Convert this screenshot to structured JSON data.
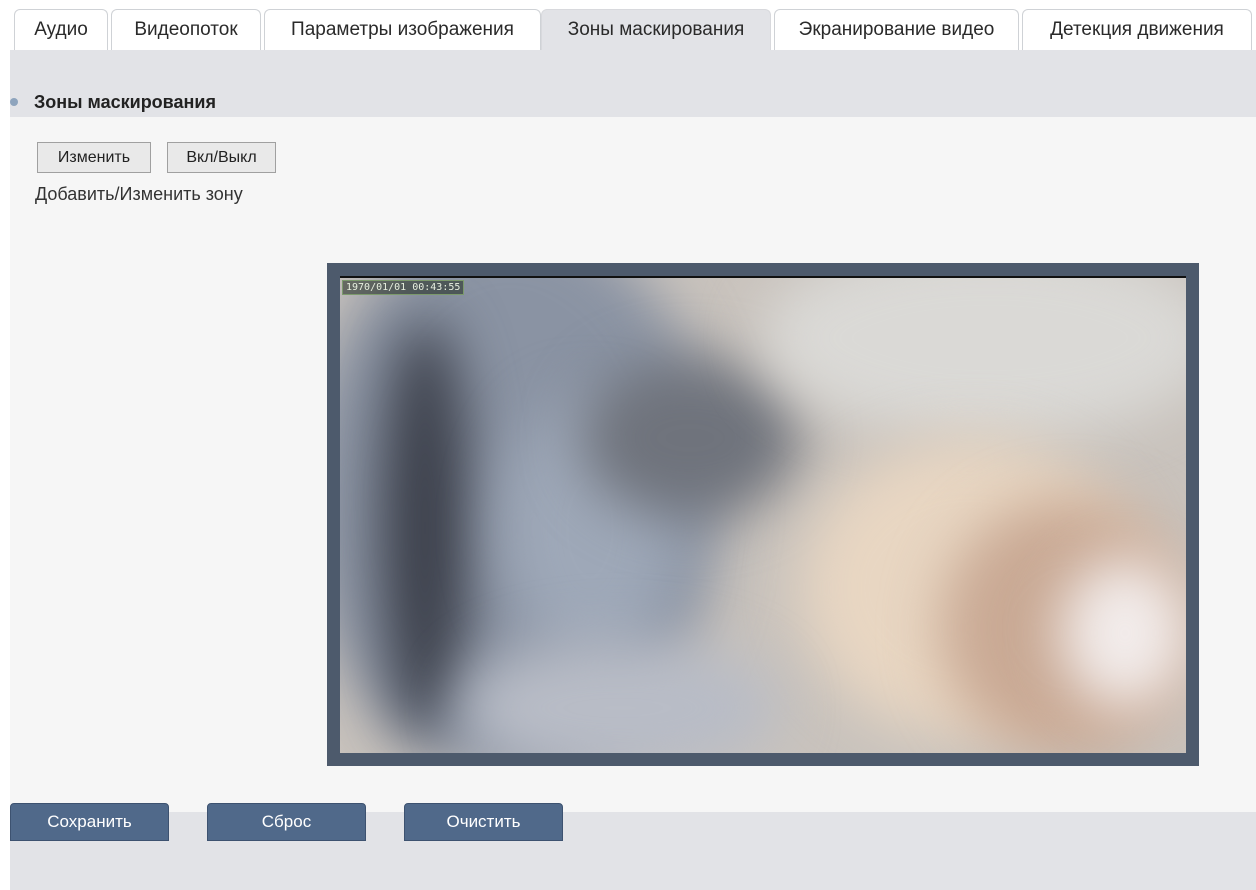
{
  "tabs": [
    {
      "label": "Аудио",
      "active": false
    },
    {
      "label": "Видеопоток",
      "active": false
    },
    {
      "label": "Параметры изображения",
      "active": false
    },
    {
      "label": "Зоны маскирования",
      "active": true
    },
    {
      "label": "Экранирование видео",
      "active": false
    },
    {
      "label": "Детекция движения",
      "active": false
    }
  ],
  "section": {
    "title": "Зоны маскирования",
    "edit_button": "Изменить",
    "toggle_button": "Вкл/Выкл",
    "hint": "Добавить/Изменить зону"
  },
  "video": {
    "timestamp": "1970/01/01 00:43:55"
  },
  "actions": {
    "save": "Сохранить",
    "reset": "Сброс",
    "clear": "Очистить"
  },
  "colors": {
    "accent": "#50698a",
    "band": "#e2e3e7",
    "video_frame": "#4d5a6c"
  }
}
